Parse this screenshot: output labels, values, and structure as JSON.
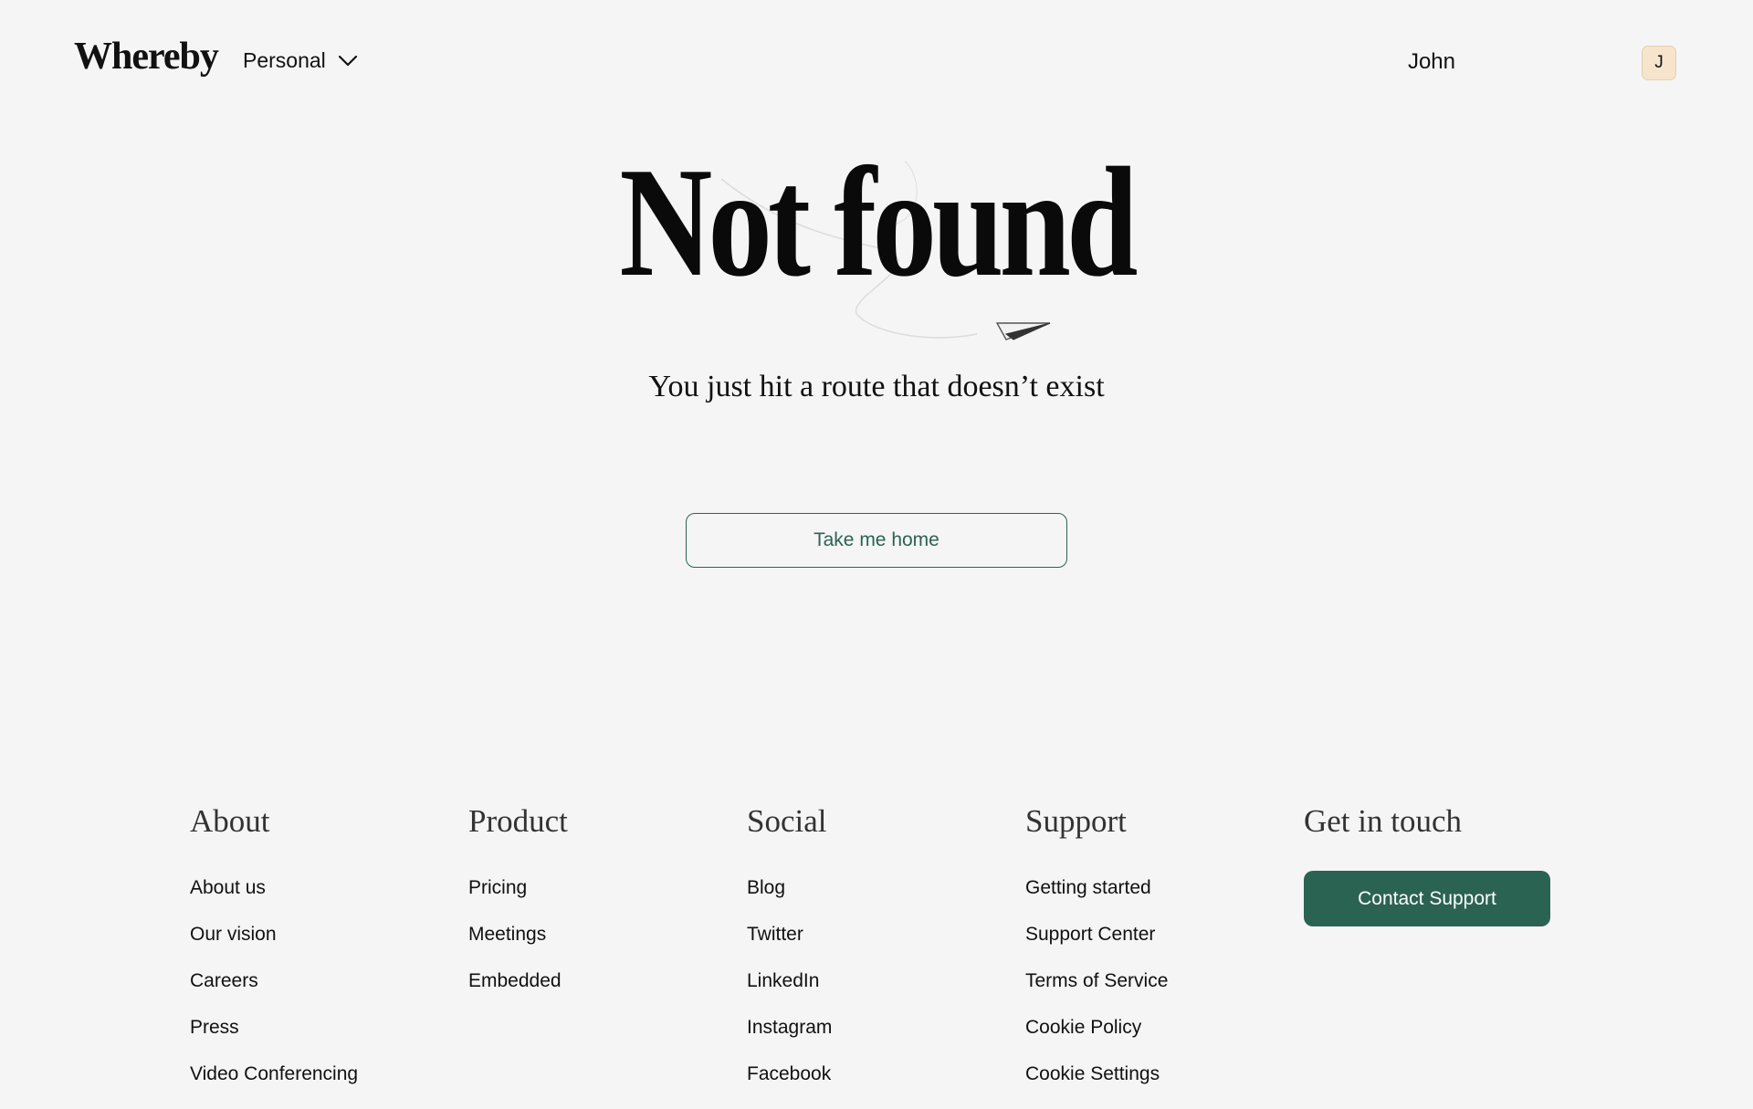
{
  "header": {
    "logo": "Whereby",
    "workspace_label": "Personal",
    "user_name": "John",
    "avatar_initial": "J"
  },
  "main": {
    "title": "Not found",
    "subtitle": "You just hit a route that doesn’t exist",
    "home_button": "Take me home"
  },
  "footer": {
    "about": {
      "heading": "About",
      "links": [
        "About us",
        "Our vision",
        "Careers",
        "Press",
        "Video Conferencing"
      ]
    },
    "product": {
      "heading": "Product",
      "links": [
        "Pricing",
        "Meetings",
        "Embedded"
      ]
    },
    "social": {
      "heading": "Social",
      "links": [
        "Blog",
        "Twitter",
        "LinkedIn",
        "Instagram",
        "Facebook"
      ]
    },
    "support": {
      "heading": "Support",
      "links": [
        "Getting started",
        "Support Center",
        "Terms of Service",
        "Cookie Policy",
        "Cookie Settings"
      ]
    },
    "contact": {
      "heading": "Get in touch",
      "button": "Contact Support"
    }
  },
  "colors": {
    "background": "#f5f5f5",
    "brand_green": "#2b6353",
    "avatar_bg": "#f7e4cc"
  },
  "icons": {
    "workspace_dropdown": "chevron-down-icon",
    "illustration": "paper-plane-icon"
  }
}
